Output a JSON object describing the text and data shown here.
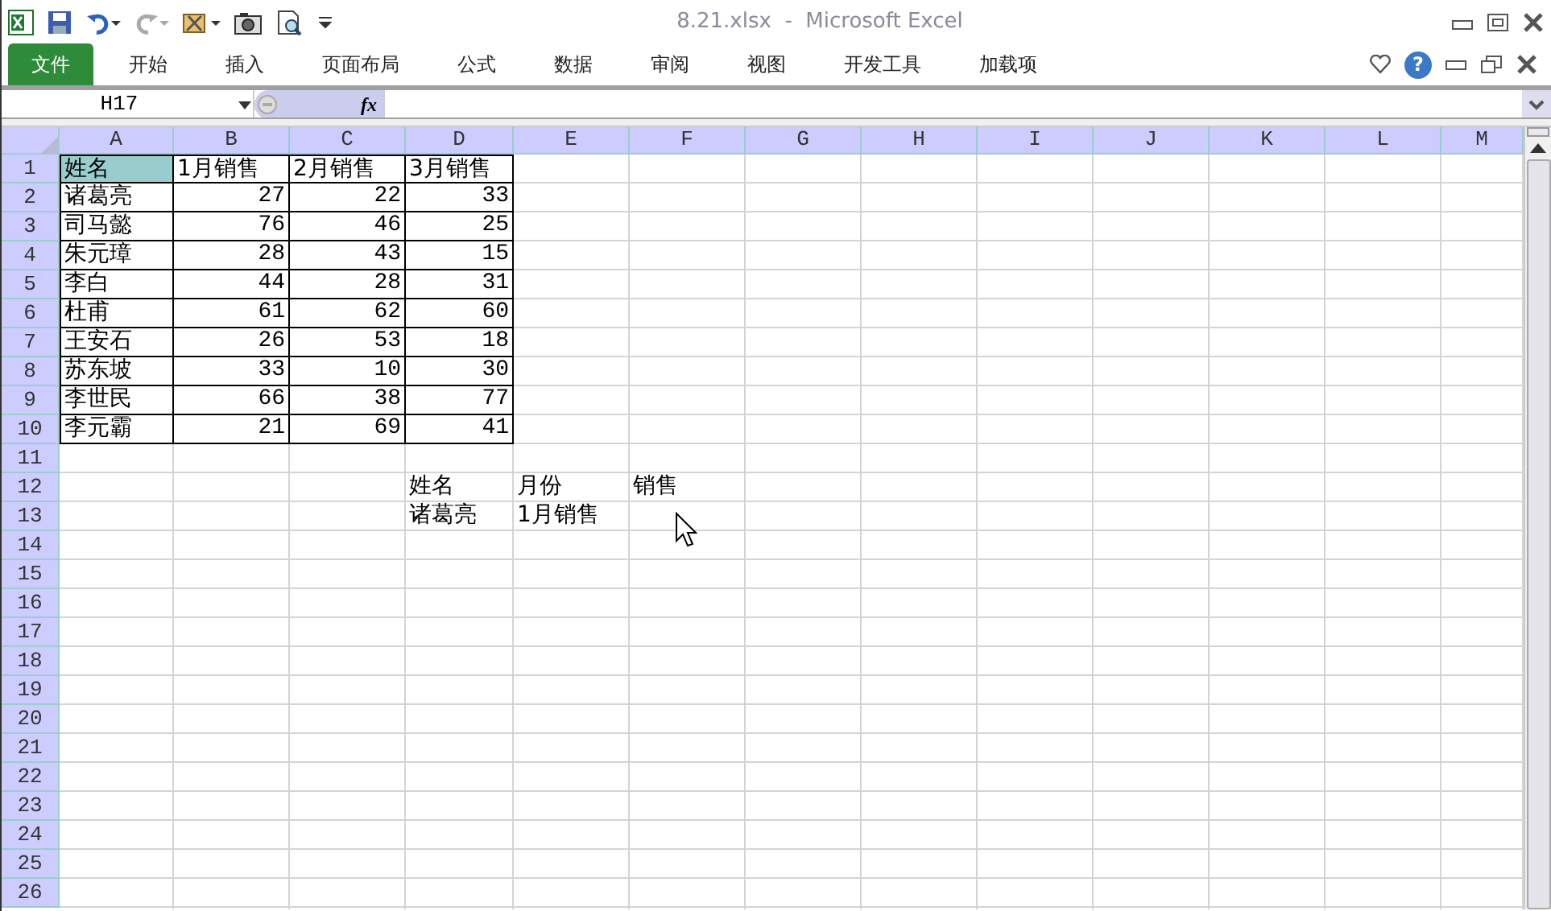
{
  "window": {
    "title": "8.21.xlsx  -  Microsoft Excel"
  },
  "ribbon": {
    "tabs": [
      {
        "label": "文件",
        "kind": "file",
        "selected": false
      },
      {
        "label": "开始",
        "kind": "tab",
        "selected": false
      },
      {
        "label": "插入",
        "kind": "tab",
        "selected": false
      },
      {
        "label": "页面布局",
        "kind": "tab",
        "selected": false
      },
      {
        "label": "公式",
        "kind": "tab",
        "selected": false
      },
      {
        "label": "数据",
        "kind": "tab",
        "selected": false
      },
      {
        "label": "审阅",
        "kind": "tab",
        "selected": false
      },
      {
        "label": "视图",
        "kind": "tab",
        "selected": false
      },
      {
        "label": "开发工具",
        "kind": "tab",
        "selected": false
      },
      {
        "label": "加载项",
        "kind": "tab",
        "selected": false
      }
    ],
    "help_label": "?"
  },
  "formula_bar": {
    "name_box": "H17",
    "function_label": "fx"
  },
  "sheet": {
    "columns": [
      "A",
      "B",
      "C",
      "D",
      "E",
      "F",
      "G",
      "H",
      "I",
      "J",
      "K",
      "L",
      "M"
    ],
    "rows": [
      {
        "number": "1",
        "cells": [
          {
            "kind": "text",
            "text": "姓名",
            "bordered": true,
            "highlighted": true
          },
          {
            "kind": "text",
            "text": "1月销售",
            "bordered": true,
            "highlighted": false
          },
          {
            "kind": "text",
            "text": "2月销售",
            "bordered": true,
            "highlighted": false
          },
          {
            "kind": "text",
            "text": "3月销售",
            "bordered": true,
            "highlighted": false
          }
        ]
      },
      {
        "number": "2",
        "cells": [
          {
            "kind": "text",
            "text": "诸葛亮",
            "bordered": true,
            "highlighted": false
          },
          {
            "kind": "number",
            "text": "27",
            "bordered": true,
            "highlighted": false
          },
          {
            "kind": "number",
            "text": "22",
            "bordered": true,
            "highlighted": false
          },
          {
            "kind": "number",
            "text": "33",
            "bordered": true,
            "highlighted": false
          }
        ]
      },
      {
        "number": "3",
        "cells": [
          {
            "kind": "text",
            "text": "司马懿",
            "bordered": true,
            "highlighted": false
          },
          {
            "kind": "number",
            "text": "76",
            "bordered": true,
            "highlighted": false
          },
          {
            "kind": "number",
            "text": "46",
            "bordered": true,
            "highlighted": false
          },
          {
            "kind": "number",
            "text": "25",
            "bordered": true,
            "highlighted": false
          }
        ]
      },
      {
        "number": "4",
        "cells": [
          {
            "kind": "text",
            "text": "朱元璋",
            "bordered": true,
            "highlighted": false
          },
          {
            "kind": "number",
            "text": "28",
            "bordered": true,
            "highlighted": false
          },
          {
            "kind": "number",
            "text": "43",
            "bordered": true,
            "highlighted": false
          },
          {
            "kind": "number",
            "text": "15",
            "bordered": true,
            "highlighted": false
          }
        ]
      },
      {
        "number": "5",
        "cells": [
          {
            "kind": "text",
            "text": "李白",
            "bordered": true,
            "highlighted": false
          },
          {
            "kind": "number",
            "text": "44",
            "bordered": true,
            "highlighted": false
          },
          {
            "kind": "number",
            "text": "28",
            "bordered": true,
            "highlighted": false
          },
          {
            "kind": "number",
            "text": "31",
            "bordered": true,
            "highlighted": false
          }
        ]
      },
      {
        "number": "6",
        "cells": [
          {
            "kind": "text",
            "text": "杜甫",
            "bordered": true,
            "highlighted": false
          },
          {
            "kind": "number",
            "text": "61",
            "bordered": true,
            "highlighted": false
          },
          {
            "kind": "number",
            "text": "62",
            "bordered": true,
            "highlighted": false
          },
          {
            "kind": "number",
            "text": "60",
            "bordered": true,
            "highlighted": false
          }
        ]
      },
      {
        "number": "7",
        "cells": [
          {
            "kind": "text",
            "text": "王安石",
            "bordered": true,
            "highlighted": false
          },
          {
            "kind": "number",
            "text": "26",
            "bordered": true,
            "highlighted": false
          },
          {
            "kind": "number",
            "text": "53",
            "bordered": true,
            "highlighted": false
          },
          {
            "kind": "number",
            "text": "18",
            "bordered": true,
            "highlighted": false
          }
        ]
      },
      {
        "number": "8",
        "cells": [
          {
            "kind": "text",
            "text": "苏东坡",
            "bordered": true,
            "highlighted": false
          },
          {
            "kind": "number",
            "text": "33",
            "bordered": true,
            "highlighted": false
          },
          {
            "kind": "number",
            "text": "10",
            "bordered": true,
            "highlighted": false
          },
          {
            "kind": "number",
            "text": "30",
            "bordered": true,
            "highlighted": false
          }
        ]
      },
      {
        "number": "9",
        "cells": [
          {
            "kind": "text",
            "text": "李世民",
            "bordered": true,
            "highlighted": false
          },
          {
            "kind": "number",
            "text": "66",
            "bordered": true,
            "highlighted": false
          },
          {
            "kind": "number",
            "text": "38",
            "bordered": true,
            "highlighted": false
          },
          {
            "kind": "number",
            "text": "77",
            "bordered": true,
            "highlighted": false
          }
        ]
      },
      {
        "number": "10",
        "cells": [
          {
            "kind": "text",
            "text": "李元霸",
            "bordered": true,
            "highlighted": false
          },
          {
            "kind": "number",
            "text": "21",
            "bordered": true,
            "highlighted": false
          },
          {
            "kind": "number",
            "text": "69",
            "bordered": true,
            "highlighted": false
          },
          {
            "kind": "number",
            "text": "41",
            "bordered": true,
            "highlighted": false
          }
        ]
      },
      {
        "number": "11"
      },
      {
        "number": "12",
        "cells": [
          {
            "kind": "blank"
          },
          {
            "kind": "blank"
          },
          {
            "kind": "blank"
          },
          {
            "kind": "text",
            "text": "姓名",
            "bordered": false,
            "highlighted": false
          },
          {
            "kind": "text",
            "text": "月份",
            "bordered": false,
            "highlighted": false
          },
          {
            "kind": "text",
            "text": "销售",
            "bordered": false,
            "highlighted": false
          }
        ]
      },
      {
        "number": "13",
        "cells": [
          {
            "kind": "blank"
          },
          {
            "kind": "blank"
          },
          {
            "kind": "blank"
          },
          {
            "kind": "text",
            "text": "诸葛亮",
            "bordered": false,
            "highlighted": false
          },
          {
            "kind": "text",
            "text": "1月销售",
            "bordered": false,
            "highlighted": false
          }
        ]
      },
      {
        "number": "14"
      },
      {
        "number": "15"
      },
      {
        "number": "16"
      },
      {
        "number": "17"
      },
      {
        "number": "18"
      },
      {
        "number": "19"
      },
      {
        "number": "20"
      },
      {
        "number": "21"
      },
      {
        "number": "22"
      },
      {
        "number": "23"
      },
      {
        "number": "24"
      },
      {
        "number": "25"
      },
      {
        "number": "26"
      }
    ]
  }
}
